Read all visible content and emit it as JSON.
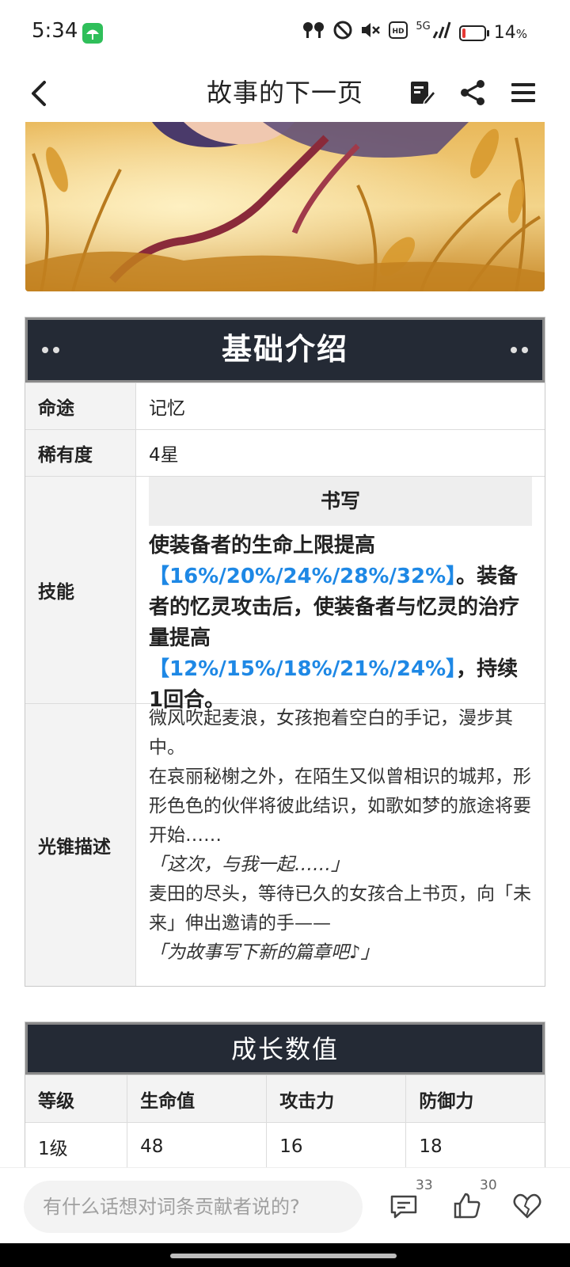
{
  "status_bar": {
    "time": "5:34",
    "network": "5G",
    "battery_percent": "14",
    "battery_unit": "%",
    "battery_level": 0.14
  },
  "header": {
    "title": "故事的下一页",
    "icons": [
      "back-icon",
      "edit-icon",
      "share-icon",
      "menu-icon"
    ]
  },
  "basic_intro": {
    "title": "基础介绍",
    "path_label": "命途",
    "path_value": "记忆",
    "rarity_label": "稀有度",
    "rarity_value": "4星",
    "skill_label": "技能",
    "skill_name": "书写",
    "skill_desc": {
      "p1": "使装备者的生命上限提高",
      "v1": "【16%/20%/24%/28%/32%】",
      "p2": "。装备者的忆灵攻击后，使装备者与忆灵的治疗量提高",
      "v2": "【12%/15%/18%/21%/24%】",
      "p3": "，持续1回合。"
    },
    "lore_label": "光锥描述",
    "lore": [
      {
        "text": "微风吹起麦浪，女孩抱着空白的手记，漫步其中。",
        "italic": false
      },
      {
        "text": "在哀丽秘榭之外，在陌生又似曾相识的城邦，形形色色的伙伴将彼此结识，如歌如梦的旅途将要开始……",
        "italic": false
      },
      {
        "text": "「这次，与我一起……」",
        "italic": true
      },
      {
        "text": "麦田的尽头，等待已久的女孩合上书页，向「未来」伸出邀请的手——",
        "italic": false
      },
      {
        "text": "「为故事写下新的篇章吧♪」",
        "italic": true
      }
    ]
  },
  "growth": {
    "title": "成长数值",
    "headers": [
      "等级",
      "生命值",
      "攻击力",
      "防御力"
    ],
    "rows": [
      [
        "1级",
        "48",
        "16",
        "18"
      ]
    ]
  },
  "bottom_bar": {
    "comment_placeholder": "有什么话想对词条贡献者说的?",
    "comment_count": "33",
    "like_count": "30"
  },
  "colors": {
    "accent_blue": "#1e88e5",
    "table_header_bg": "#242a35",
    "app_icon_green": "#2fbf5a",
    "battery_low": "#e53935"
  }
}
